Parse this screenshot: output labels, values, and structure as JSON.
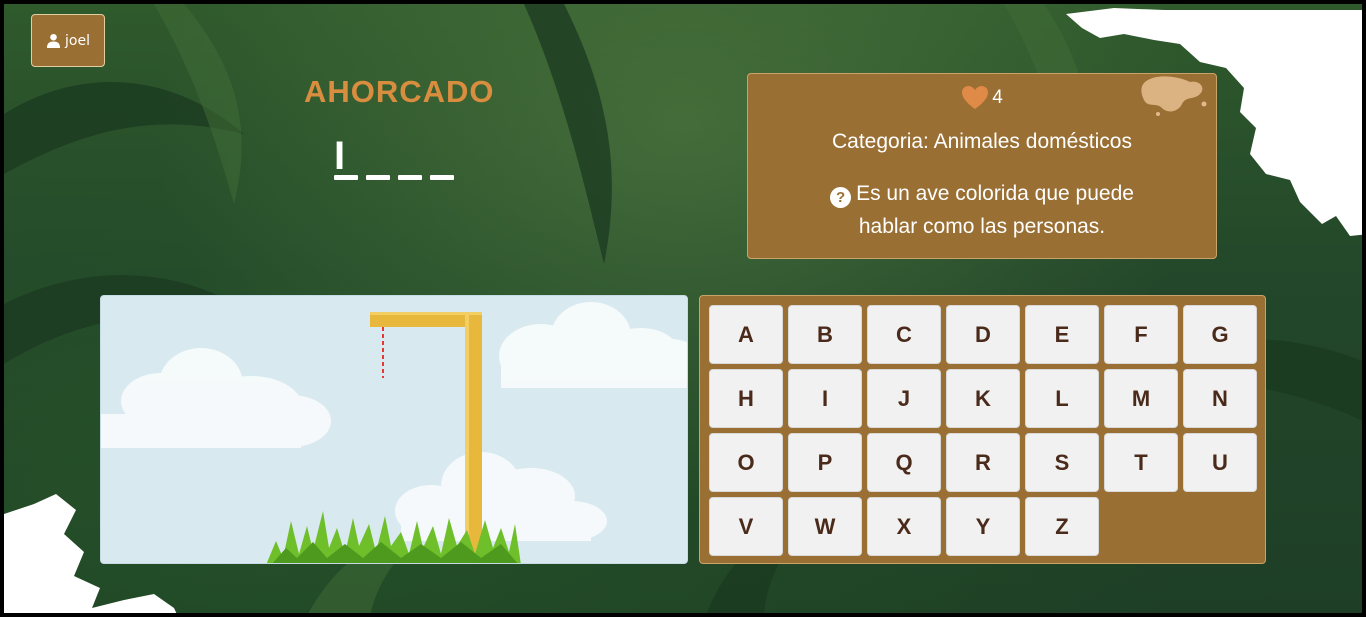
{
  "user": {
    "name": "joel",
    "icon": "user-icon"
  },
  "game": {
    "title": "AHORCADO",
    "word_slots": [
      "I",
      "",
      "",
      ""
    ],
    "lives": "4",
    "category": "Categoria: Animales domésticos",
    "hint": "Es un ave colorida que puede hablar como las personas.",
    "hint_icon": "question-circle-icon",
    "heart_icon": "heart-icon"
  },
  "keyboard": {
    "keys": [
      "A",
      "B",
      "C",
      "D",
      "E",
      "F",
      "G",
      "H",
      "I",
      "J",
      "K",
      "L",
      "M",
      "N",
      "O",
      "P",
      "Q",
      "R",
      "S",
      "T",
      "U",
      "V",
      "W",
      "X",
      "Y",
      "Z"
    ]
  },
  "colors": {
    "panel_brown": "#9a6f34",
    "title_orange": "#d98d3e",
    "heart_orange": "#e08a48",
    "key_text": "#4a2a1a",
    "sky": "#d8e9f0",
    "gallows_wood": "#e8b83c",
    "rope_red": "#e53935",
    "grass_green": "#6fbf2a"
  }
}
